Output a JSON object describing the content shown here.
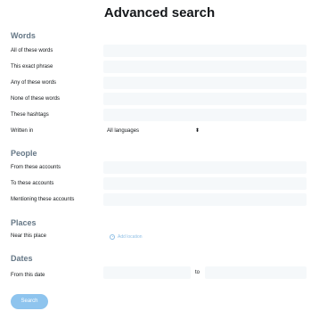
{
  "title": "Advanced search",
  "words": {
    "heading": "Words",
    "all_label": "All of these words",
    "exact_label": "This exact phrase",
    "any_label": "Any of these words",
    "none_label": "None of these words",
    "hashtags_label": "These hashtags",
    "language_label": "Written in",
    "language_value": "All languages",
    "language_caret": "⬍"
  },
  "people": {
    "heading": "People",
    "from_label": "From these accounts",
    "to_label": "To these accounts",
    "mentioning_label": "Mentioning these accounts"
  },
  "places": {
    "heading": "Places",
    "near_label": "Near this place",
    "add_location": "Add location"
  },
  "dates": {
    "heading": "Dates",
    "from_label": "From this date",
    "to_label": "to"
  },
  "search_button": "Search",
  "colors": {
    "field_bg": "#f5f8fa",
    "section_gray": "#657786",
    "accent": "#8ec4ee"
  }
}
